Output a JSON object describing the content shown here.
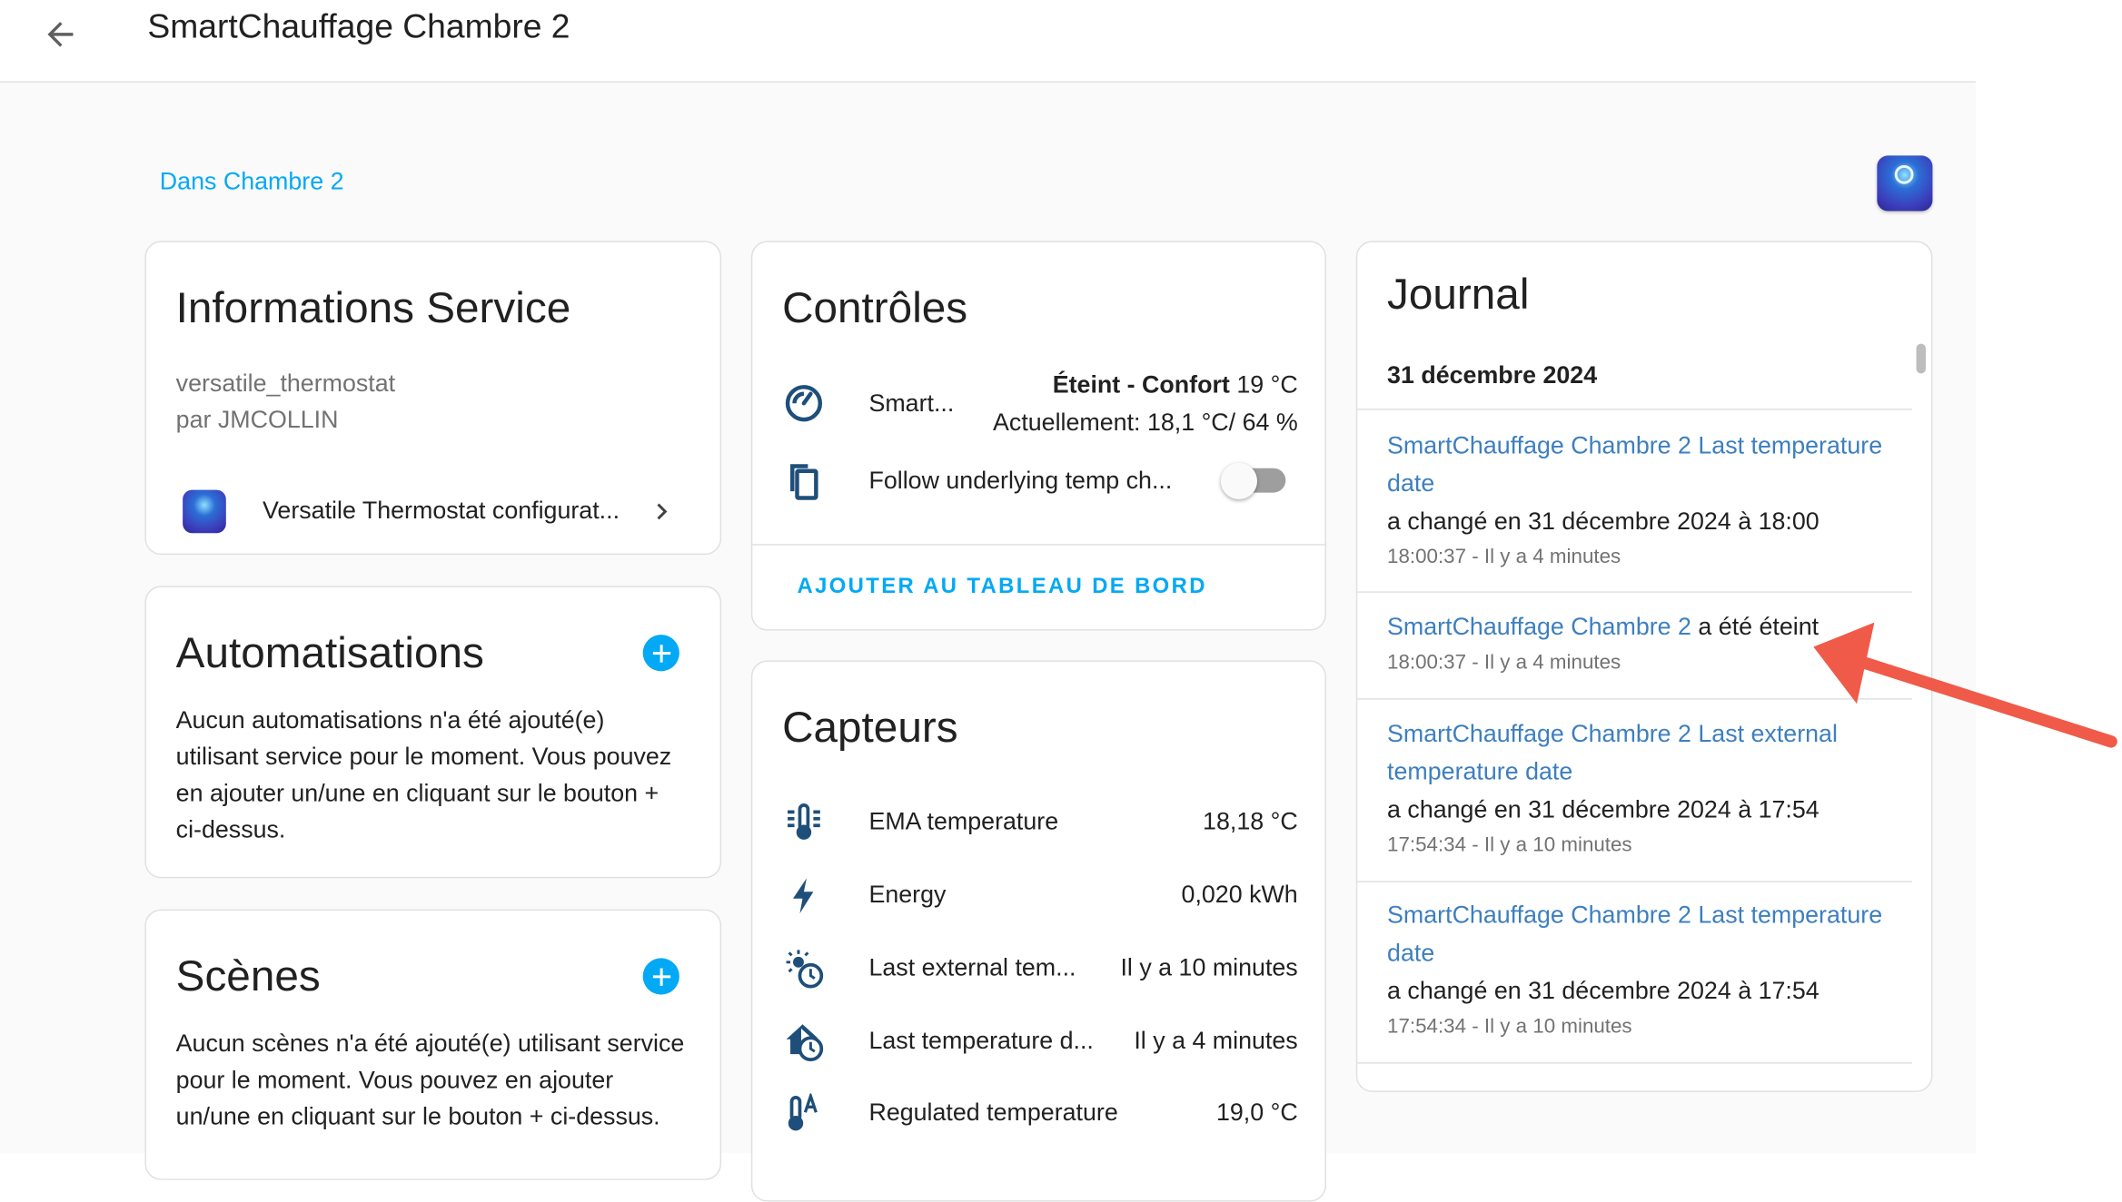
{
  "header": {
    "title": "SmartChauffage Chambre 2"
  },
  "area": {
    "link_label": "Dans Chambre 2"
  },
  "info_card": {
    "title": "Informations Service",
    "integration": "versatile_thermostat",
    "author": "par JMCOLLIN",
    "config_entry_label": "Versatile Thermostat configurat..."
  },
  "automations_card": {
    "title": "Automatisations",
    "empty_text": "Aucun automatisations n'a été ajouté(e) utilisant service pour le moment. Vous pouvez en ajouter un/une en cliquant sur le bouton + ci-dessus."
  },
  "scenes_card": {
    "title": "Scènes",
    "empty_text": "Aucun scènes n'a été ajouté(e) utilisant service pour le moment. Vous pouvez en ajouter un/une en cliquant sur le bouton + ci-dessus."
  },
  "controls_card": {
    "title": "Contrôles",
    "climate": {
      "name": "Smart...",
      "state": "Éteint - Confort",
      "setpoint": "19 °C",
      "current": "Actuellement: 18,1 °C/ 64 %"
    },
    "follow": {
      "name": "Follow underlying temp ch...",
      "on": false
    },
    "add_button": "AJOUTER AU TABLEAU DE BORD"
  },
  "sensors_card": {
    "title": "Capteurs",
    "rows": [
      {
        "icon": "thermometer-lines-icon",
        "label": "EMA temperature",
        "value": "18,18 °C"
      },
      {
        "icon": "lightning-bolt-icon",
        "label": "Energy",
        "value": "0,020 kWh"
      },
      {
        "icon": "sun-clock-icon",
        "label": "Last external tem...",
        "value": "Il y a 10 minutes"
      },
      {
        "icon": "home-clock-icon",
        "label": "Last temperature d...",
        "value": "Il y a 4 minutes"
      },
      {
        "icon": "thermometer-auto-icon",
        "label": "Regulated temperature",
        "value": "19,0 °C"
      }
    ]
  },
  "journal_card": {
    "title": "Journal",
    "date": "31 décembre 2024",
    "entries": [
      {
        "entity": "SmartChauffage Chambre 2 Last temperature date",
        "message": "a changé en 31 décembre 2024 à 18:00",
        "time": "18:00:37 - Il y a 4 minutes"
      },
      {
        "entity": "SmartChauffage Chambre 2",
        "message": "a été éteint",
        "time": "18:00:37 - Il y a 4 minutes"
      },
      {
        "entity": "SmartChauffage Chambre 2 Last external temperature date",
        "message": "a changé en 31 décembre 2024 à 17:54",
        "time": "17:54:34 - Il y a 10 minutes"
      },
      {
        "entity": "SmartChauffage Chambre 2 Last temperature date",
        "message": "a changé en 31 décembre 2024 à 17:54",
        "time": "17:54:34 - Il y a 10 minutes"
      }
    ]
  },
  "colors": {
    "accent": "#03a9f4",
    "link": "#3d7fbf",
    "arrow": "#f05a48",
    "icon": "#1e4f7a"
  }
}
